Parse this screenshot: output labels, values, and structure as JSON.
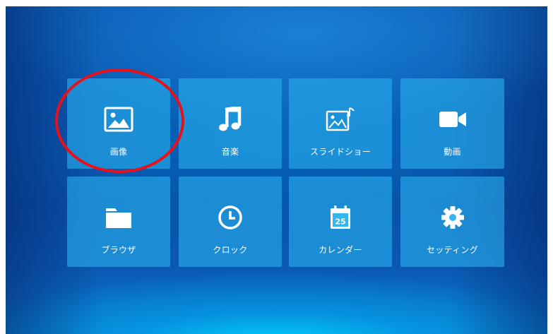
{
  "menu": {
    "tiles": [
      {
        "label": "画像",
        "icon": "image-icon"
      },
      {
        "label": "音楽",
        "icon": "music-note-icon"
      },
      {
        "label": "スライドショー",
        "icon": "slideshow-icon"
      },
      {
        "label": "動画",
        "icon": "video-camera-icon"
      },
      {
        "label": "ブラウザ",
        "icon": "folder-icon"
      },
      {
        "label": "クロック",
        "icon": "clock-icon"
      },
      {
        "label": "カレンダー",
        "icon": "calendar-icon",
        "icon_text": "25"
      },
      {
        "label": "セッティング",
        "icon": "gear-icon"
      }
    ]
  },
  "annotation": {
    "highlight_color": "#e8101a",
    "highlighted_tile": "画像"
  },
  "colors": {
    "background": "#0a4fa8",
    "tile": "#28afeb",
    "text": "#ffffff"
  }
}
